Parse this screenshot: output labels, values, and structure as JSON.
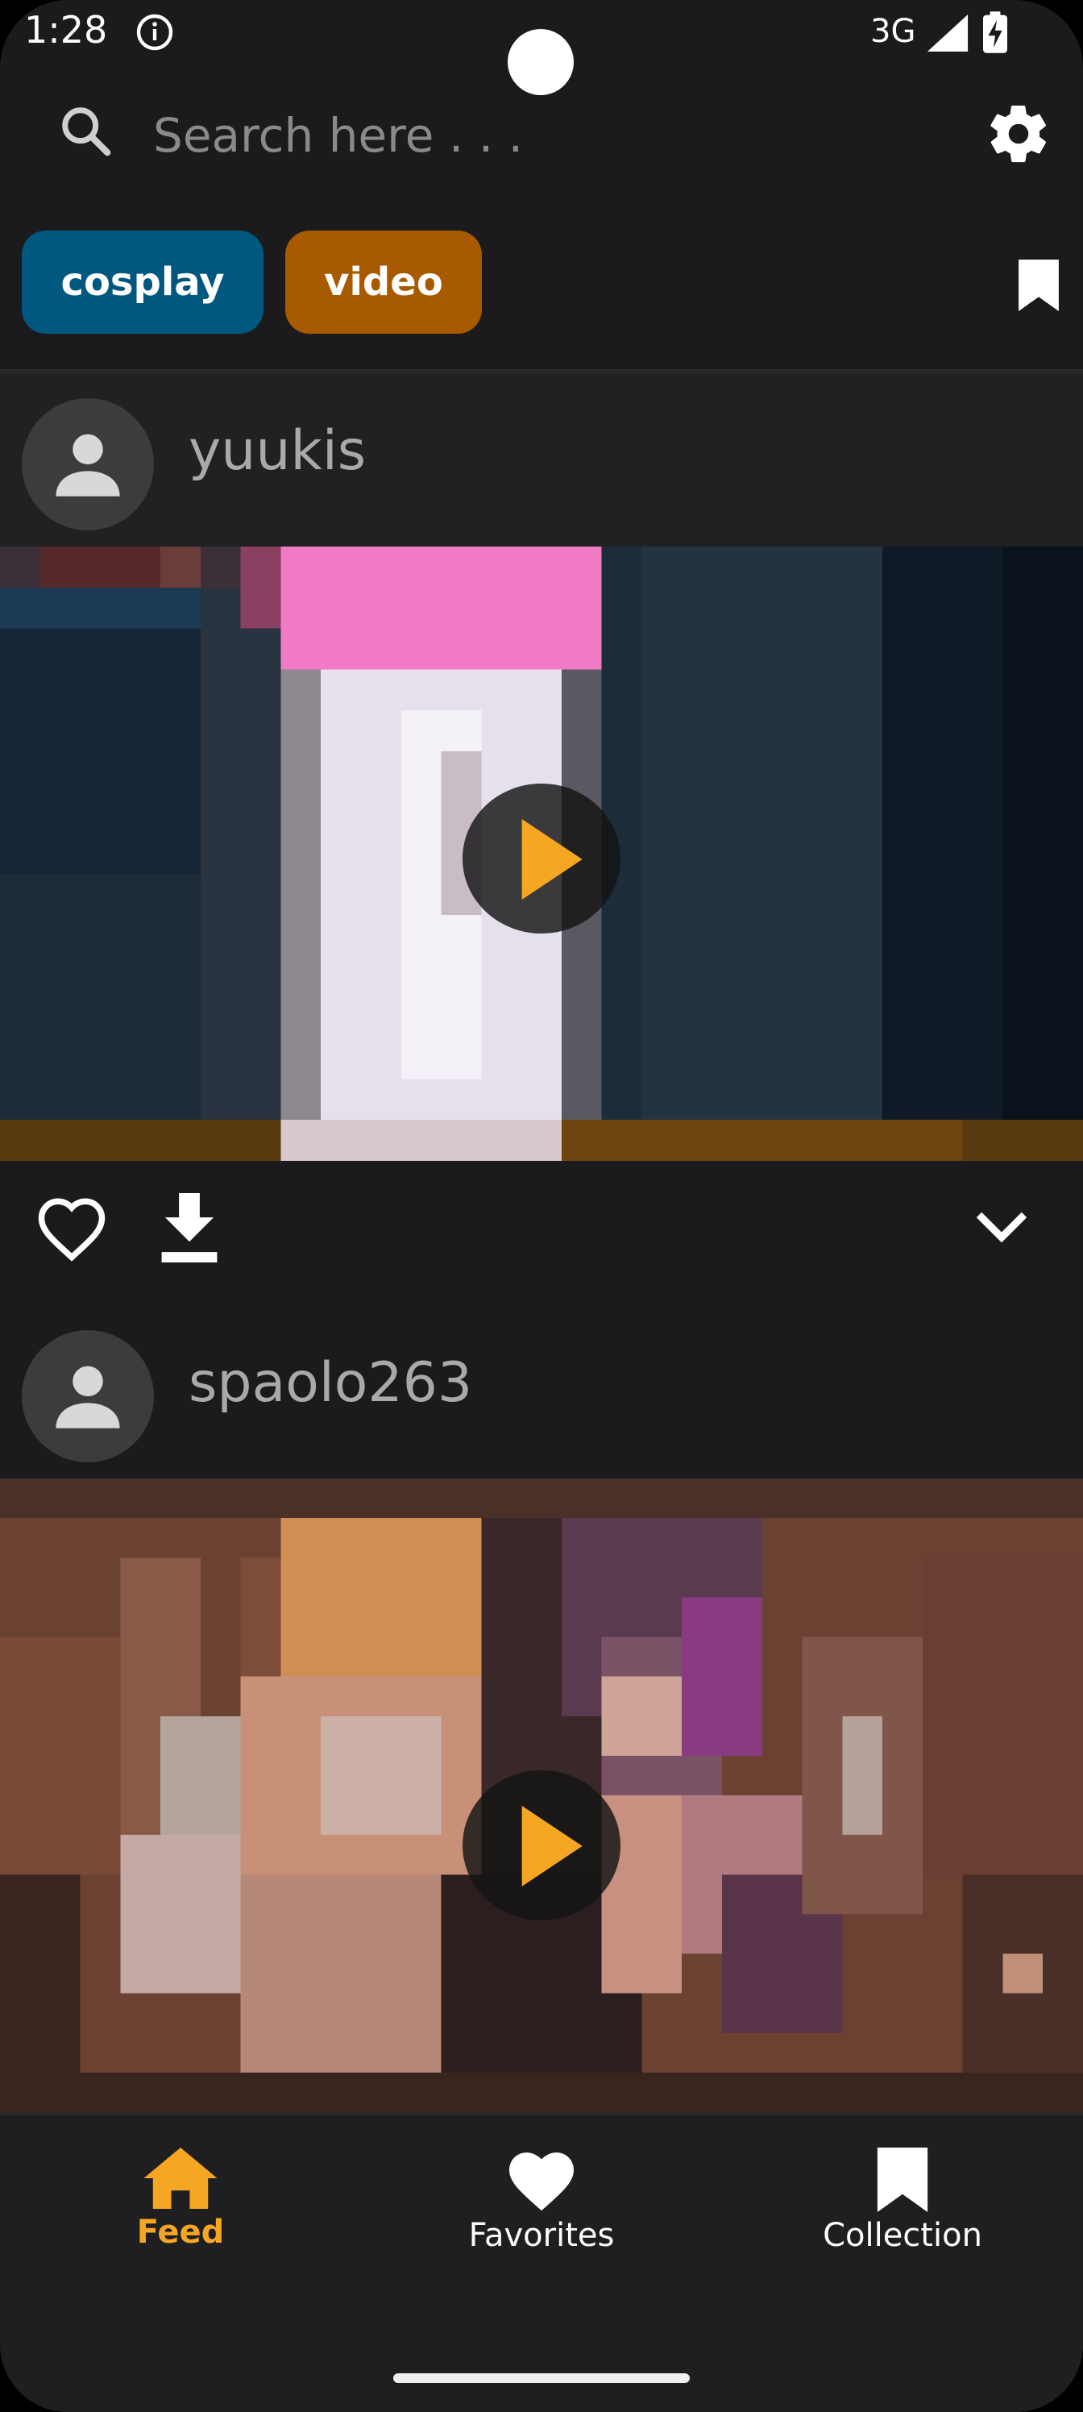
{
  "status_bar": {
    "time": "1:28",
    "network": "3G"
  },
  "search": {
    "placeholder": "Search here . . ."
  },
  "tags": [
    {
      "label": "cosplay",
      "color": "#00587f"
    },
    {
      "label": "video",
      "color": "#a85a00"
    }
  ],
  "posts": [
    {
      "username": "yuukis"
    },
    {
      "username": "spaolo263"
    }
  ],
  "bottom_nav": {
    "items": [
      {
        "label": "Feed",
        "icon": "home-icon",
        "active": true
      },
      {
        "label": "Favorites",
        "icon": "heart-icon",
        "active": false
      },
      {
        "label": "Collection",
        "icon": "bookmark-icon",
        "active": false
      }
    ],
    "active_color": "#f5a623"
  },
  "colors": {
    "background": "#1b1b1d",
    "accent": "#f5a623"
  }
}
